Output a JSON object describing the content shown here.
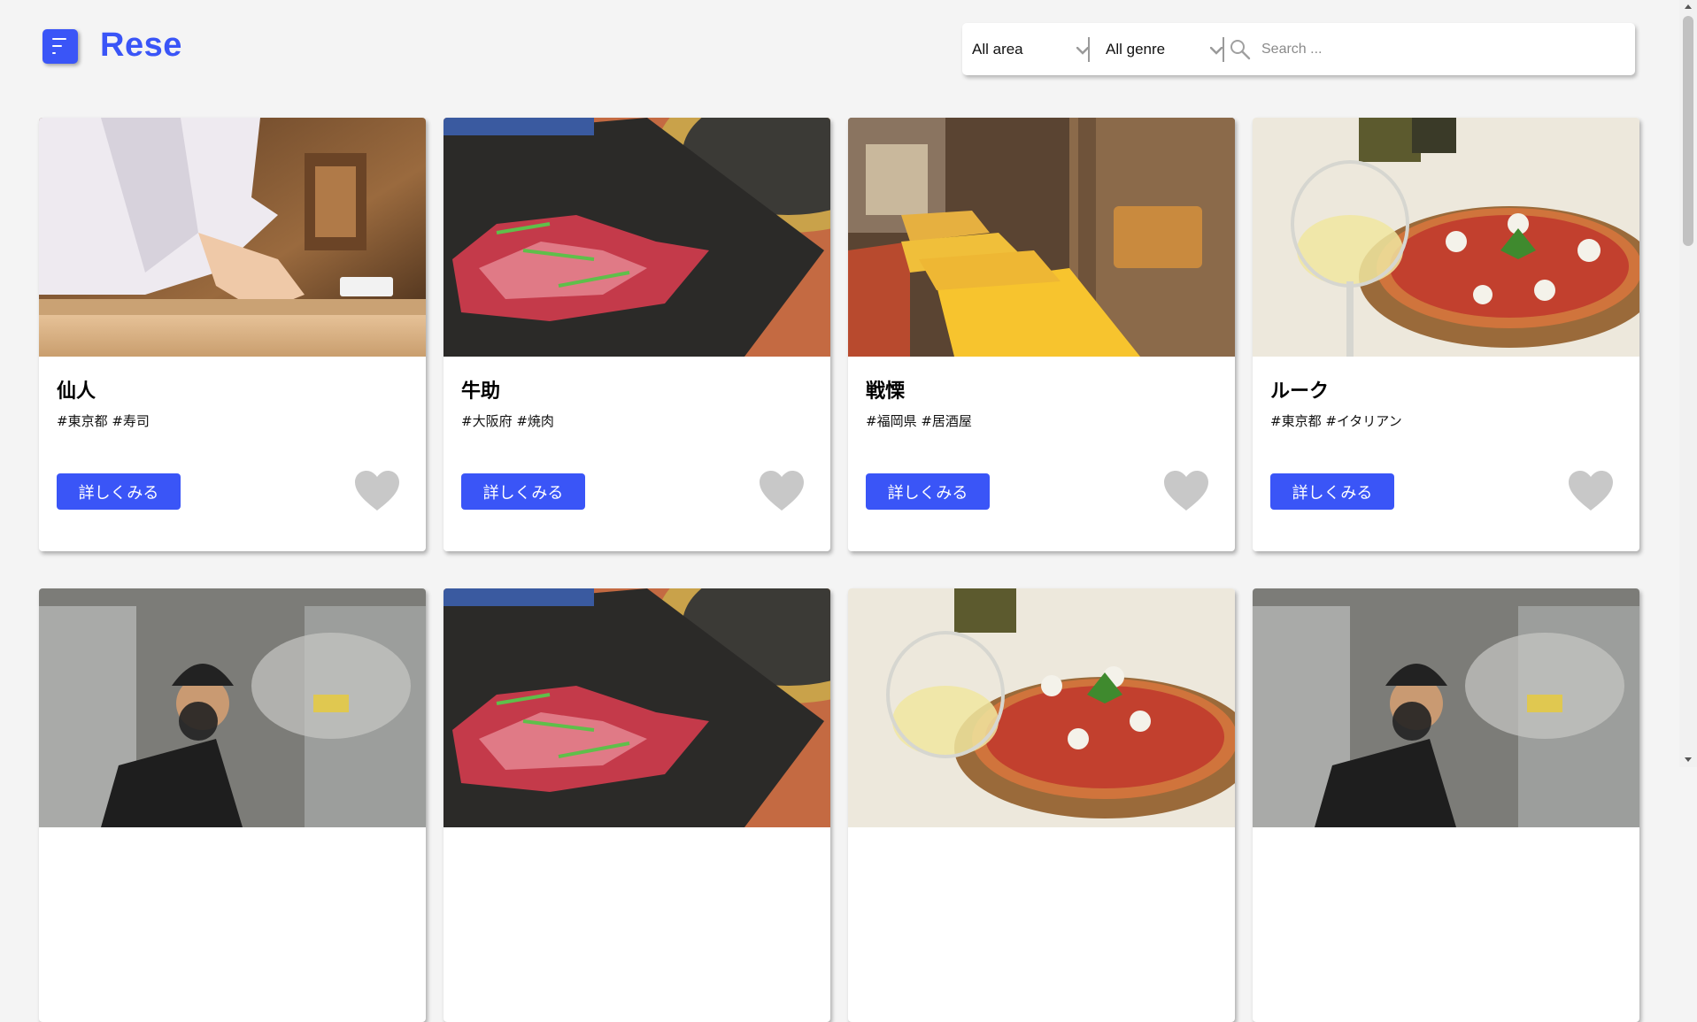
{
  "header": {
    "brand": "Rese",
    "area_select": "All area",
    "genre_select": "All genre",
    "search_placeholder": "Search ..."
  },
  "cards": [
    {
      "name": "仙人",
      "tags": "#東京都 #寿司",
      "button": "詳しくみる",
      "photo": "sushi-chef-photo"
    },
    {
      "name": "牛助",
      "tags": "#大阪府 #焼肉",
      "button": "詳しくみる",
      "photo": "yakiniku-beef-photo"
    },
    {
      "name": "戦慄",
      "tags": "#福岡県 #居酒屋",
      "button": "詳しくみる",
      "photo": "izakaya-interior-photo"
    },
    {
      "name": "ルーク",
      "tags": "#東京都 #イタリアン",
      "button": "詳しくみる",
      "photo": "pizza-wine-photo"
    },
    {
      "photo": "kitchen-chef-photo"
    },
    {
      "photo": "yakiniku-beef-photo"
    },
    {
      "photo": "pizza-wine-photo"
    },
    {
      "photo": "kitchen-chef-photo"
    }
  ],
  "icons": {
    "menu": "menu-icon",
    "chevron": "chevron-down-icon",
    "search": "search-icon",
    "favorite": "heart-icon"
  },
  "colors": {
    "accent": "#3a55f7",
    "heart_inactive": "#c8c8c8",
    "background": "#f4f4f4"
  }
}
